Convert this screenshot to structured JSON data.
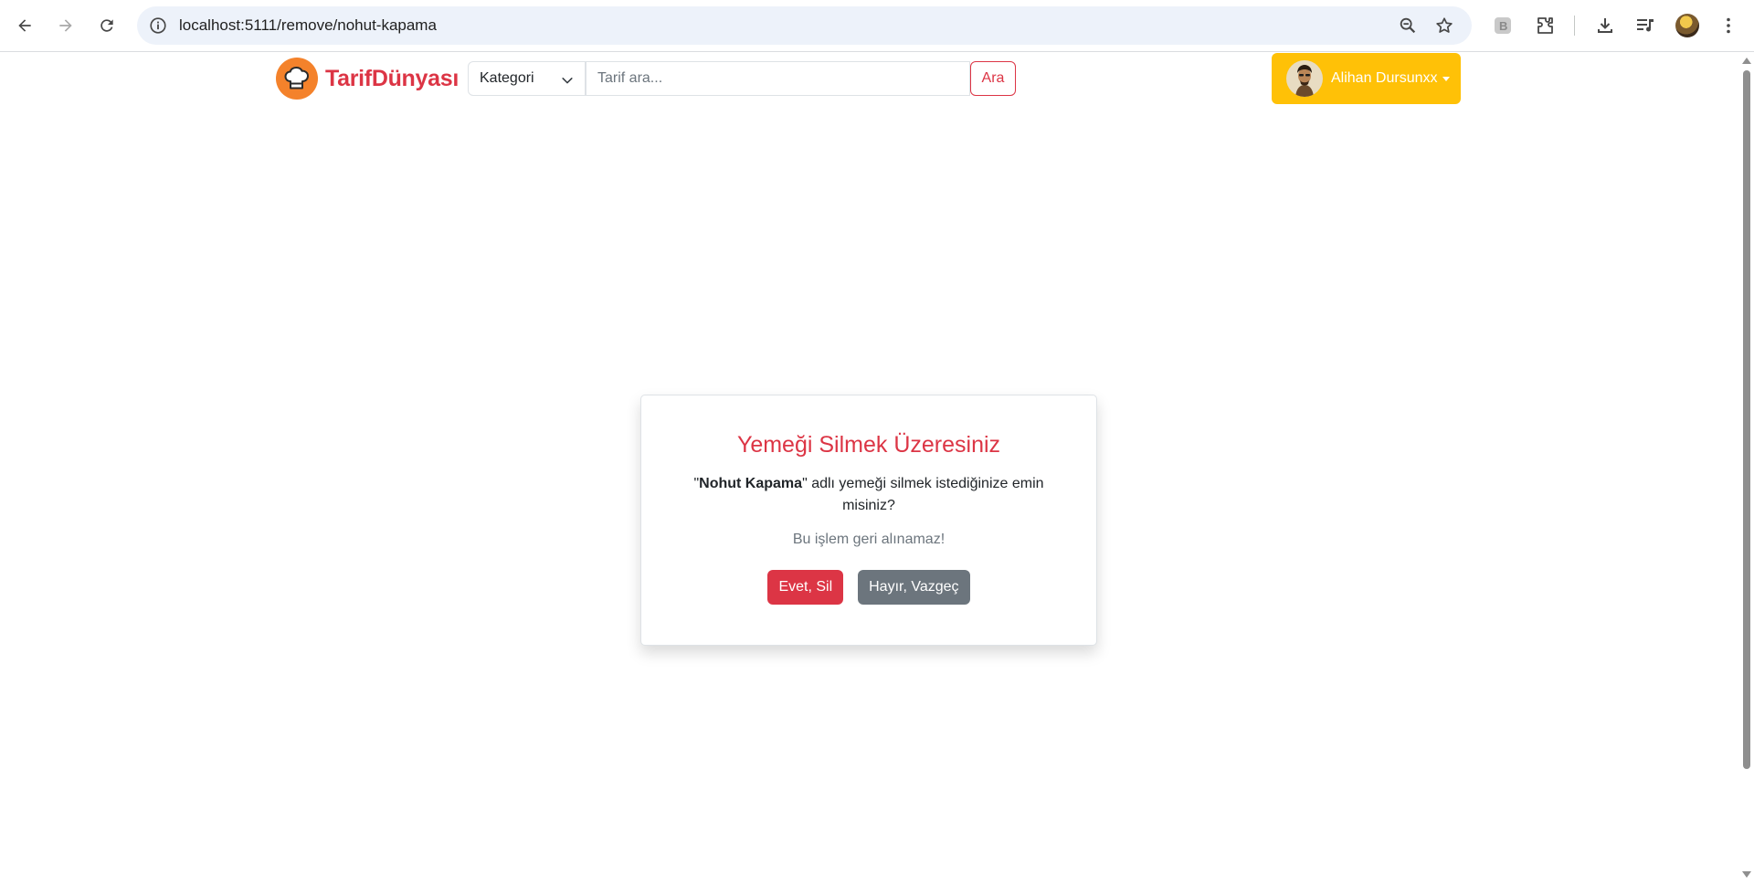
{
  "browser": {
    "url": "localhost:5111/remove/nohut-kapama",
    "icons": [
      "back-arrow-icon",
      "forward-arrow-icon",
      "reload-icon",
      "site-info-icon",
      "zoom-icon",
      "star-icon",
      "extension-b-icon",
      "puzzle-icon",
      "download-icon",
      "media-icon",
      "profile-avatar",
      "more-menu-icon"
    ]
  },
  "navbar": {
    "brand_text": "TarifDünyası",
    "category_label": "Kategori",
    "search_placeholder": "Tarif ara...",
    "search_button": "Ara",
    "user_name": "Alihan Dursunxx"
  },
  "dialog": {
    "title": "Yemeği Silmek Üzeresiniz",
    "quote_open": "\"",
    "recipe_name": "Nohut Kapama",
    "message_rest": "\" adlı yemeği silmek istediğinize emin misiniz?",
    "note": "Bu işlem geri alınamaz!",
    "confirm_button": "Evet, Sil",
    "cancel_button": "Hayır, Vazgeç"
  },
  "colors": {
    "danger": "#dc3545",
    "warning": "#ffc107",
    "secondary": "#6c757d",
    "logo_orange": "#f4822b"
  }
}
